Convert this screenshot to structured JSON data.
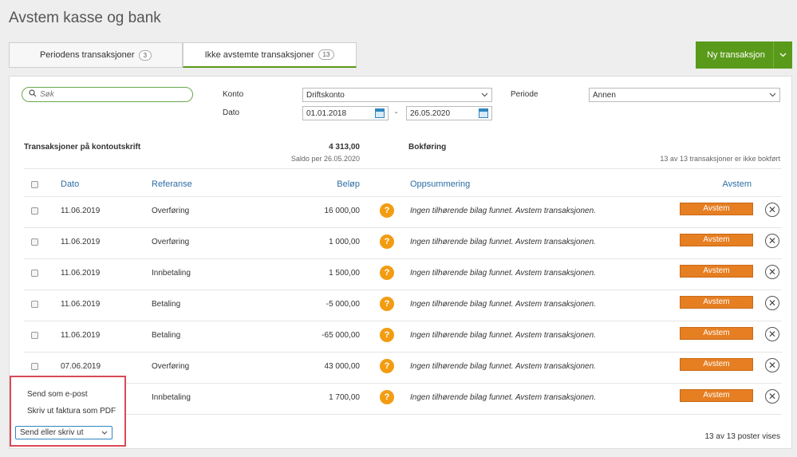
{
  "page": {
    "title": "Avstem kasse og bank"
  },
  "tabs": [
    {
      "label": "Periodens transaksjoner",
      "count": "3"
    },
    {
      "label": "Ikke avstemte transaksjoner",
      "count": "13"
    }
  ],
  "new_button": {
    "label": "Ny transaksjon"
  },
  "filters": {
    "search_placeholder": "Søk",
    "konto_label": "Konto",
    "konto_value": "Driftskonto",
    "periode_label": "Periode",
    "periode_value": "Annen",
    "dato_label": "Dato",
    "date_from": "01.01.2018",
    "date_to": "26.05.2020",
    "date_sep": "-"
  },
  "summary": {
    "left_title": "Transaksjoner på kontoutskrift",
    "amount": "4 313,00",
    "saldo": "Saldo per 26.05.2020",
    "bokforing": "Bokføring",
    "right_status": "13 av 13 transaksjoner er ikke bokført"
  },
  "table": {
    "headers": {
      "dato": "Dato",
      "referanse": "Referanse",
      "belop": "Beløp",
      "oppsummering": "Oppsummering",
      "avstem": "Avstem"
    },
    "rows": [
      {
        "dato": "11.06.2019",
        "referanse": "Overføring",
        "belop": "16 000,00",
        "summary": "Ingen tilhørende bilag funnet. Avstem transaksjonen.",
        "action": "Avstem"
      },
      {
        "dato": "11.06.2019",
        "referanse": "Overføring",
        "belop": "1 000,00",
        "summary": "Ingen tilhørende bilag funnet. Avstem transaksjonen.",
        "action": "Avstem"
      },
      {
        "dato": "11.06.2019",
        "referanse": "Innbetaling",
        "belop": "1 500,00",
        "summary": "Ingen tilhørende bilag funnet. Avstem transaksjonen.",
        "action": "Avstem"
      },
      {
        "dato": "11.06.2019",
        "referanse": "Betaling",
        "belop": "-5 000,00",
        "summary": "Ingen tilhørende bilag funnet. Avstem transaksjonen.",
        "action": "Avstem"
      },
      {
        "dato": "11.06.2019",
        "referanse": "Betaling",
        "belop": "-65 000,00",
        "summary": "Ingen tilhørende bilag funnet. Avstem transaksjonen.",
        "action": "Avstem"
      },
      {
        "dato": "07.06.2019",
        "referanse": "Overføring",
        "belop": "43 000,00",
        "summary": "Ingen tilhørende bilag funnet. Avstem transaksjonen.",
        "action": "Avstem"
      },
      {
        "dato": "",
        "referanse": "Innbetaling",
        "belop": "1 700,00",
        "summary": "Ingen tilhørende bilag funnet. Avstem transaksjonen.",
        "action": "Avstem"
      }
    ]
  },
  "popup": {
    "item1": "Send som e-post",
    "item2": "Skriv ut faktura som PDF",
    "dropdown": "Send eller skriv ut"
  },
  "footer": {
    "count": "13 av 13 poster vises"
  },
  "colors": {
    "green": "#5a9a1a",
    "orange": "#e67e22",
    "link_blue": "#2e6da4",
    "highlight_red": "#d94a55"
  }
}
